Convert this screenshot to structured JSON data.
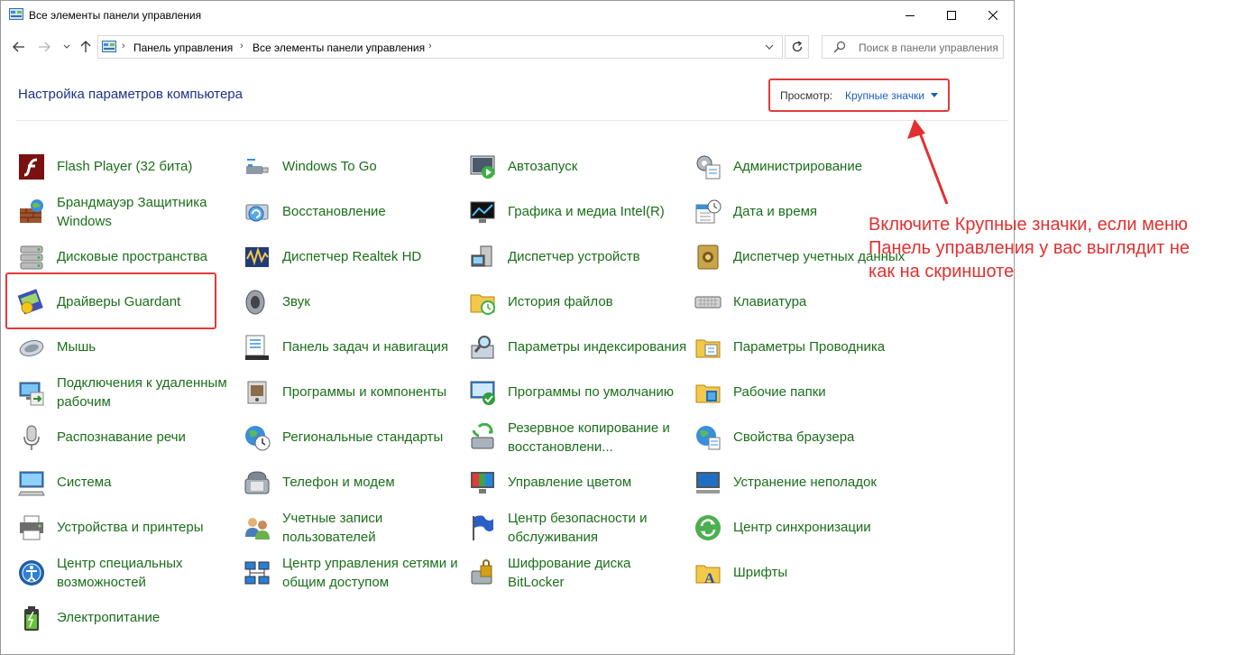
{
  "window": {
    "title": "Все элементы панели управления"
  },
  "address": {
    "breadcrumbs": [
      "Панель управления",
      "Все элементы панели управления"
    ],
    "search_placeholder": "Поиск в панели управления"
  },
  "header": {
    "title": "Настройка параметров компьютера",
    "view_label": "Просмотр:",
    "view_value": "Крупные значки"
  },
  "items": [
    [
      {
        "label": "Flash Player (32 бита)",
        "icon": "flash-icon"
      },
      {
        "label": "Брандмауэр Защитника Windows",
        "icon": "firewall-icon"
      },
      {
        "label": "Дисковые пространства",
        "icon": "storage-spaces-icon"
      },
      {
        "label": "Драйверы Guardant",
        "icon": "guardant-icon"
      },
      {
        "label": "Мышь",
        "icon": "mouse-icon"
      },
      {
        "label": "Подключения к удаленным рабочим",
        "icon": "remote-connections-icon"
      },
      {
        "label": "Распознавание речи",
        "icon": "microphone-icon"
      },
      {
        "label": "Система",
        "icon": "system-icon"
      },
      {
        "label": "Устройства и принтеры",
        "icon": "printer-icon"
      },
      {
        "label": "Центр специальных возможностей",
        "icon": "accessibility-icon"
      },
      {
        "label": "Электропитание",
        "icon": "battery-icon"
      }
    ],
    [
      {
        "label": "Windows To Go",
        "icon": "usb-drive-icon"
      },
      {
        "label": "Восстановление",
        "icon": "recovery-icon"
      },
      {
        "label": "Диспетчер Realtek HD",
        "icon": "realtek-icon"
      },
      {
        "label": "Звук",
        "icon": "speaker-icon"
      },
      {
        "label": "Панель задач и навигация",
        "icon": "taskbar-icon"
      },
      {
        "label": "Программы и компоненты",
        "icon": "programs-icon"
      },
      {
        "label": "Региональные стандарты",
        "icon": "globe-clock-icon"
      },
      {
        "label": "Телефон и модем",
        "icon": "phone-icon"
      },
      {
        "label": "Учетные записи пользователей",
        "icon": "users-icon"
      },
      {
        "label": "Центр управления сетями и общим доступом",
        "icon": "network-icon"
      }
    ],
    [
      {
        "label": "Автозапуск",
        "icon": "autoplay-icon"
      },
      {
        "label": "Графика и медиа Intel(R)",
        "icon": "intel-graphics-icon"
      },
      {
        "label": "Диспетчер устройств",
        "icon": "device-manager-icon"
      },
      {
        "label": "История файлов",
        "icon": "file-history-icon"
      },
      {
        "label": "Параметры индексирования",
        "icon": "indexing-icon"
      },
      {
        "label": "Программы по умолчанию",
        "icon": "default-programs-icon"
      },
      {
        "label": "Резервное копирование и восстановлени...",
        "icon": "backup-icon"
      },
      {
        "label": "Управление цветом",
        "icon": "color-management-icon"
      },
      {
        "label": "Центр безопасности и обслуживания",
        "icon": "flag-icon"
      },
      {
        "label": "Шифрование диска BitLocker",
        "icon": "bitlocker-icon"
      }
    ],
    [
      {
        "label": "Администрирование",
        "icon": "admin-tools-icon"
      },
      {
        "label": "Дата и время",
        "icon": "calendar-clock-icon"
      },
      {
        "label": "Диспетчер учетных данных",
        "icon": "credential-vault-icon"
      },
      {
        "label": "Клавиатура",
        "icon": "keyboard-icon"
      },
      {
        "label": "Параметры Проводника",
        "icon": "explorer-options-icon"
      },
      {
        "label": "Рабочие папки",
        "icon": "work-folders-icon"
      },
      {
        "label": "Свойства браузера",
        "icon": "internet-options-icon"
      },
      {
        "label": "Устранение неполадок",
        "icon": "troubleshoot-icon"
      },
      {
        "label": "Центр синхронизации",
        "icon": "sync-icon"
      },
      {
        "label": "Шрифты",
        "icon": "fonts-icon"
      }
    ]
  ],
  "annotation": {
    "text": "Включите Крупные значки, если меню\nПанель управления у вас выглядит не\nкак на скриншоте",
    "color": "#e23030"
  }
}
